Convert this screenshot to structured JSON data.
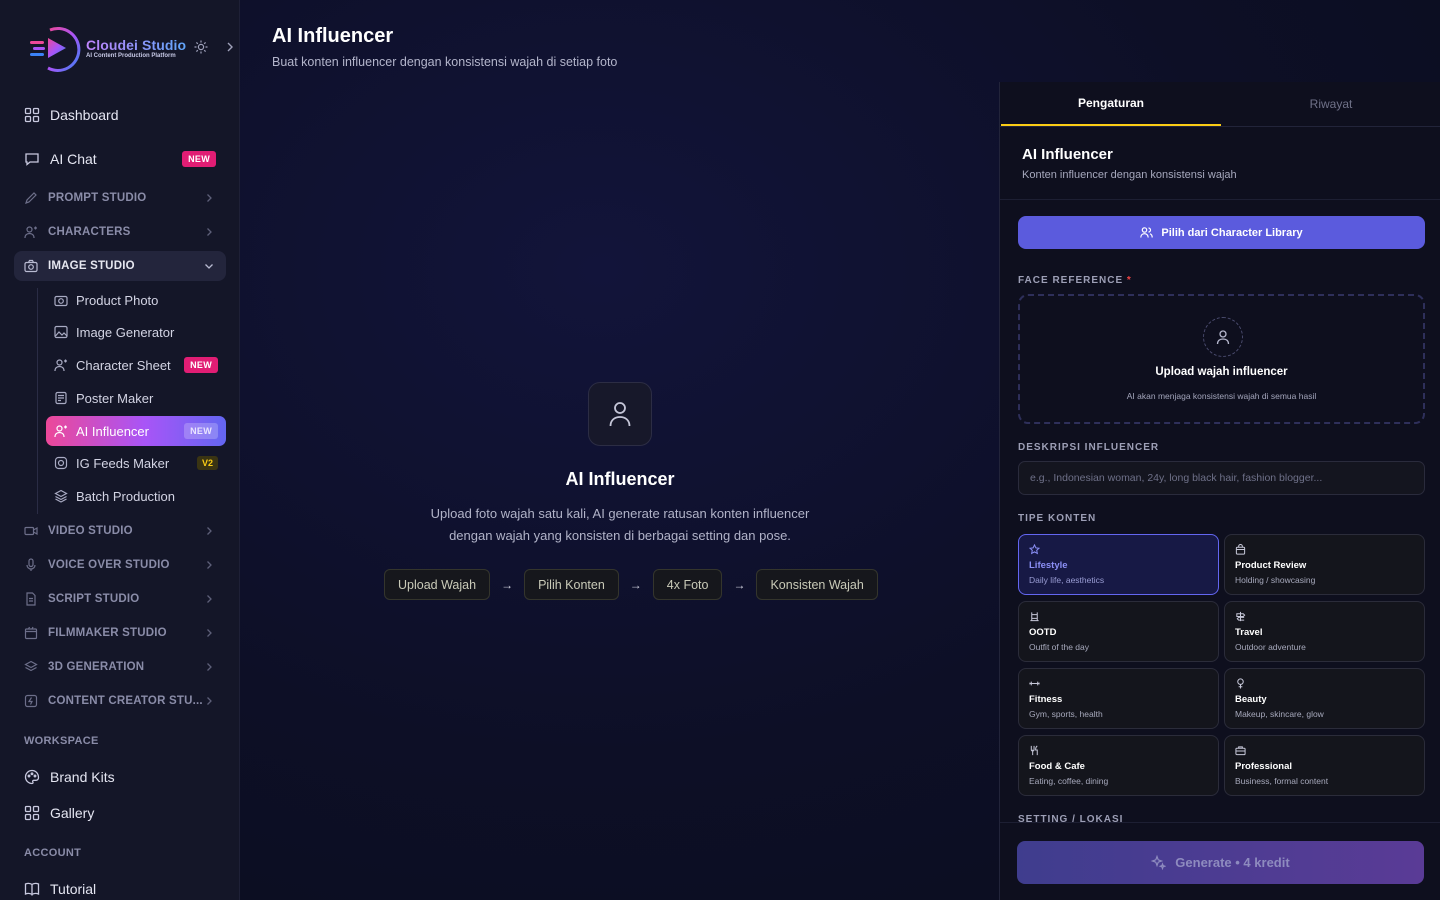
{
  "brand": {
    "name": "Cloudei Studio",
    "tagline": "AI Content Production Platform"
  },
  "sidebar": {
    "top_items": [
      {
        "label": "Dashboard",
        "icon": "grid-icon"
      },
      {
        "label": "AI Chat",
        "icon": "chat-icon",
        "badge": "NEW"
      }
    ],
    "sections": {
      "prompt_studio": "PROMPT STUDIO",
      "characters": "CHARACTERS",
      "image_studio": "IMAGE STUDIO",
      "video_studio": "VIDEO STUDIO",
      "voice_over_studio": "VOICE OVER STUDIO",
      "script_studio": "SCRIPT STUDIO",
      "filmmaker_studio": "FILMMAKER STUDIO",
      "3d_generation": "3D GENERATION",
      "content_creator_studio": "CONTENT CREATOR STU..."
    },
    "image_studio_items": [
      {
        "label": "Product Photo"
      },
      {
        "label": "Image Generator"
      },
      {
        "label": "Character Sheet",
        "badge": "NEW"
      },
      {
        "label": "Poster Maker"
      },
      {
        "label": "AI Influencer",
        "badge": "NEW",
        "active": true
      },
      {
        "label": "IG Feeds Maker",
        "badge": "V2"
      },
      {
        "label": "Batch Production"
      }
    ],
    "workspace_label": "WORKSPACE",
    "workspace_items": [
      {
        "label": "Brand Kits"
      },
      {
        "label": "Gallery"
      }
    ],
    "account_label": "ACCOUNT",
    "account_items": [
      {
        "label": "Tutorial"
      }
    ]
  },
  "main": {
    "title": "AI Influencer",
    "subtitle": "Buat konten influencer dengan konsistensi wajah di setiap foto",
    "empty_state": {
      "title": "AI Influencer",
      "desc_line1": "Upload foto wajah satu kali, AI generate ratusan konten influencer",
      "desc_line2": "dengan wajah yang konsisten di berbagai setting dan pose.",
      "steps": [
        "Upload Wajah",
        "Pilih Konten",
        "4x Foto",
        "Konsisten Wajah"
      ],
      "arrow": "→"
    }
  },
  "panel": {
    "tabs": [
      "Pengaturan",
      "Riwayat"
    ],
    "active_tab": "Pengaturan",
    "title": "AI Influencer",
    "subtitle": "Konten influencer dengan konsistensi wajah",
    "library_button": "Pilih dari Character Library",
    "face_reference_label": "FACE REFERENCE",
    "required_mark": "*",
    "upload_title": "Upload wajah influencer",
    "upload_sub": "AI akan menjaga konsistensi wajah di semua hasil",
    "description_label": "DESKRIPSI INFLUENCER",
    "description_placeholder": "e.g., Indonesian woman, 24y, long black hair, fashion blogger...",
    "description_value": "",
    "content_type_label": "TIPE KONTEN",
    "content_types": [
      {
        "name": "Lifestyle",
        "desc": "Daily life, aesthetics",
        "icon": "star-icon",
        "selected": true
      },
      {
        "name": "Product Review",
        "desc": "Holding / showcasing",
        "icon": "bag-icon"
      },
      {
        "name": "OOTD",
        "desc": "Outfit of the day",
        "icon": "hanger-icon"
      },
      {
        "name": "Travel",
        "desc": "Outdoor adventure",
        "icon": "signpost-icon"
      },
      {
        "name": "Fitness",
        "desc": "Gym, sports, health",
        "icon": "dumbbell-icon"
      },
      {
        "name": "Beauty",
        "desc": "Makeup, skincare, glow",
        "icon": "sparkle-venus-icon"
      },
      {
        "name": "Food & Cafe",
        "desc": "Eating, coffee, dining",
        "icon": "utensils-icon"
      },
      {
        "name": "Professional",
        "desc": "Business, formal content",
        "icon": "briefcase-icon"
      }
    ],
    "setting_label": "SETTING / LOKASI",
    "generate_button": "Generate • 4 kredit"
  },
  "colors": {
    "accent": "#5b5bdd",
    "active_gradient_start": "#ec4899",
    "active_gradient_end": "#6366f1",
    "badge_new": "#e11d74",
    "badge_v2": "#facc15",
    "tab_underline": "#facc15"
  }
}
